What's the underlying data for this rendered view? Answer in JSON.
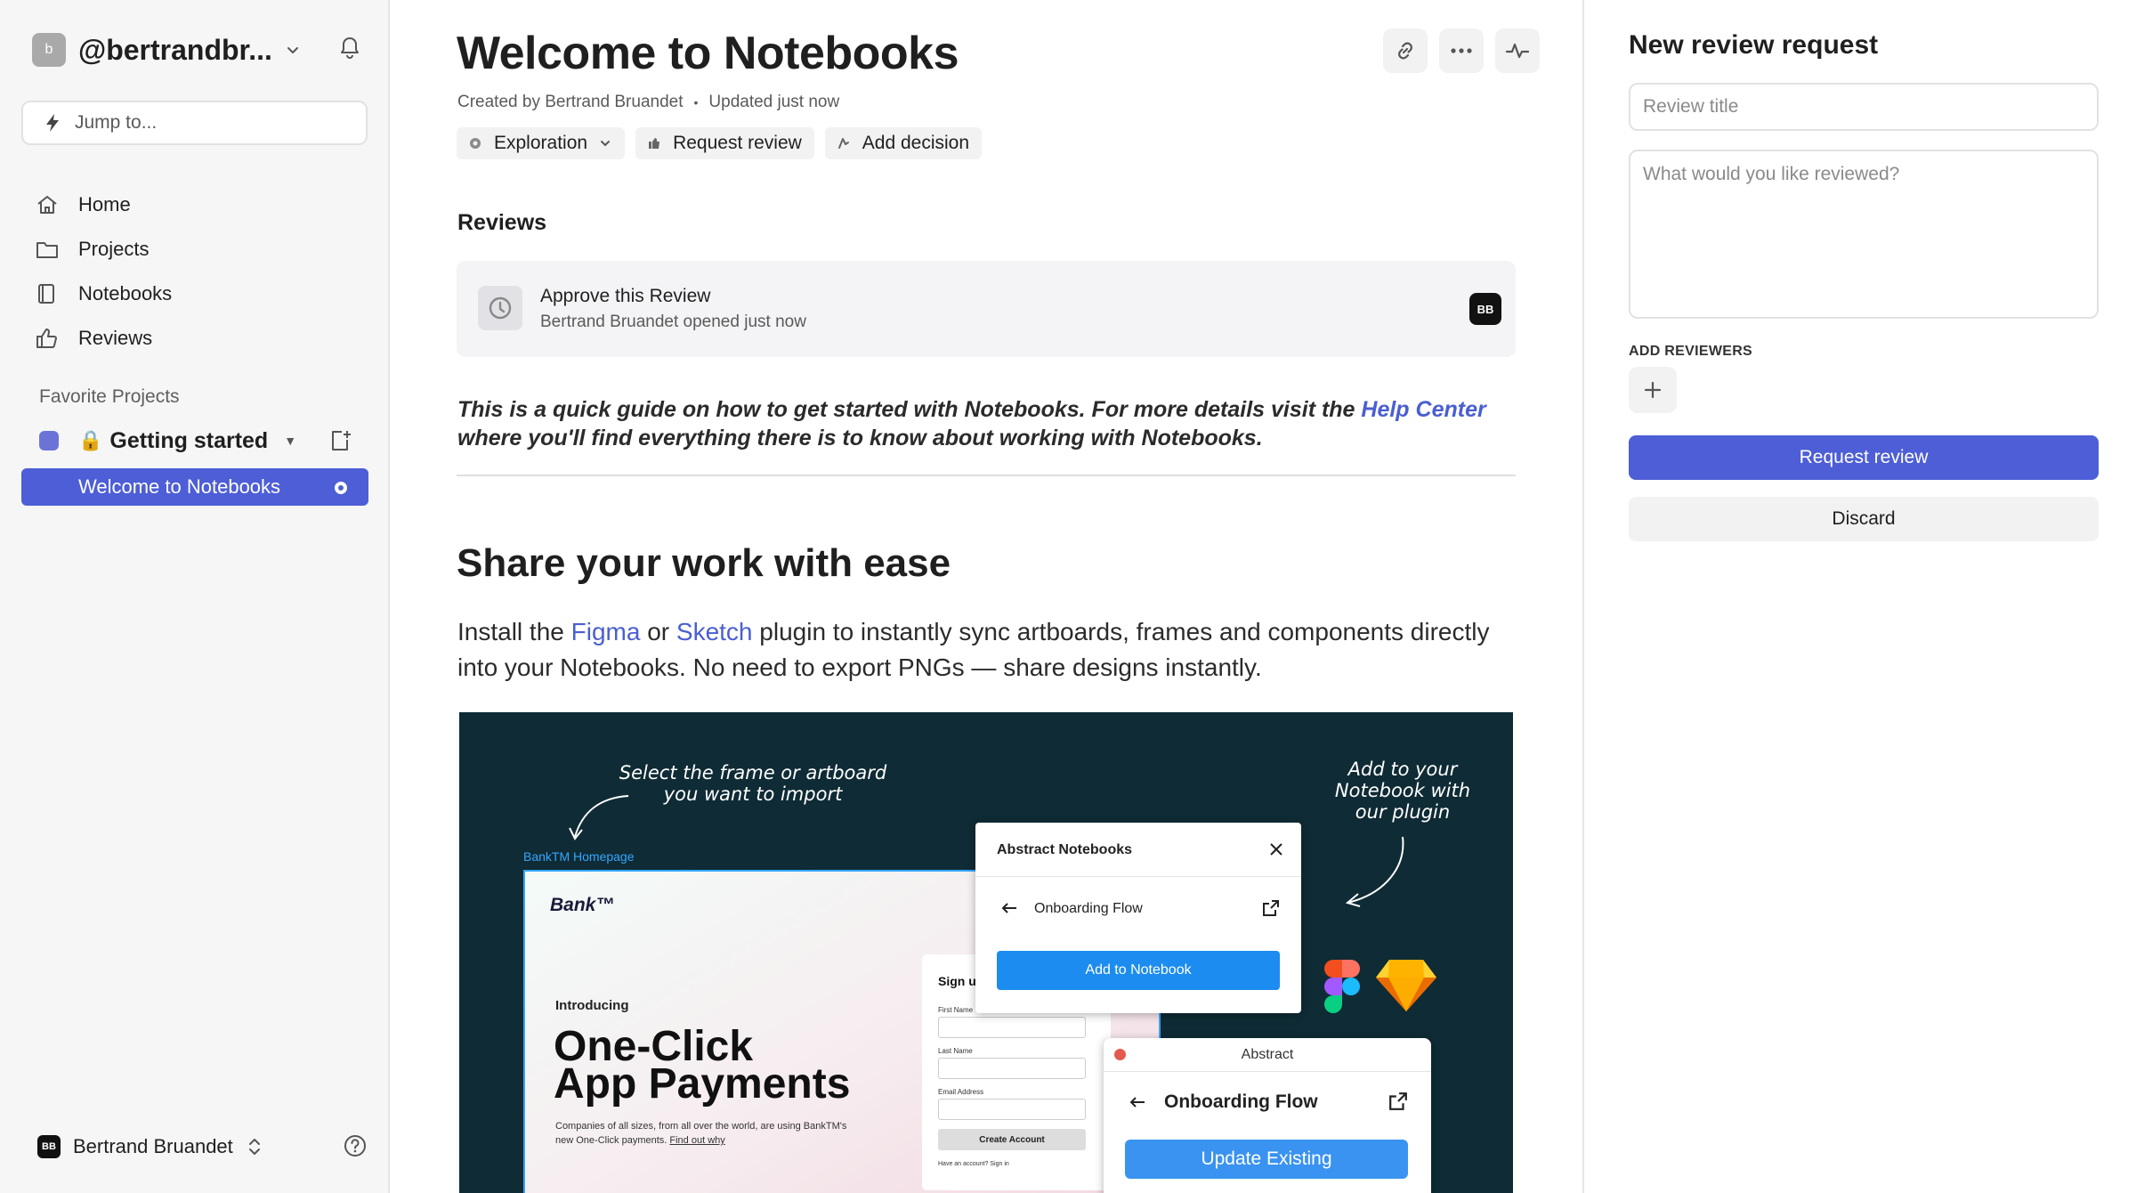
{
  "sidebar": {
    "workspace_initial": "b",
    "workspace_name": "@bertrandbr...",
    "jump_placeholder": "Jump to...",
    "nav": [
      {
        "label": "Home",
        "icon": "home-icon"
      },
      {
        "label": "Projects",
        "icon": "folder-icon"
      },
      {
        "label": "Notebooks",
        "icon": "notebook-icon"
      },
      {
        "label": "Reviews",
        "icon": "thumbs-up-icon"
      }
    ],
    "favorites_title": "Favorite Projects",
    "favorite_project": {
      "lock": "🔒",
      "name": "Getting started",
      "color": "#6b74d6"
    },
    "active_notebook": "Welcome to Notebooks",
    "user": {
      "initials": "BB",
      "name": "Bertrand Bruandet"
    }
  },
  "main": {
    "title": "Welcome to Notebooks",
    "meta": {
      "created": "Created by Bertrand Bruandet",
      "separator": "•",
      "updated": "Updated just now"
    },
    "pills": {
      "exploration": "Exploration",
      "request_review": "Request review",
      "add_decision": "Add decision"
    },
    "reviews_heading": "Reviews",
    "review": {
      "title": "Approve this Review",
      "subtitle": "Bertrand Bruandet opened just now",
      "avatar": "BB"
    },
    "intro": {
      "before": "This is a quick guide on how to get started with Notebooks. For more details visit the ",
      "link": "Help Center",
      "after": " where you'll find everything there is to know about working with Notebooks."
    },
    "section_heading": "Share your work with ease",
    "paragraph": {
      "p1": "Install the ",
      "figma": "Figma",
      "p2": " or ",
      "sketch": "Sketch",
      "p3": " plugin to instantly sync artboards, frames and components directly into your Notebooks. No need to export PNGs — share designs instantly."
    },
    "embed": {
      "annotation_left_1": "Select the frame or artboard",
      "annotation_left_2": "you want to import",
      "annotation_right_1": "Add to your",
      "annotation_right_2": "Notebook with",
      "annotation_right_3": "our plugin",
      "frame_label": "BankTM Homepage",
      "bank_logo": "Bank™",
      "introducing": "Introducing",
      "big_title_1": "One-Click",
      "big_title_2": "App Payments",
      "small_text": "Companies of all sizes, from all over the world, are using BankTM's new One-Click payments.",
      "small_link": "Find out why",
      "signup_title": "Sign up fo",
      "field_first": "First Name",
      "field_last": "Last Name",
      "field_email": "Email Address",
      "create_account": "Create Account",
      "have_account": "Have an account? Sign in",
      "plugin_title": "Abstract Notebooks",
      "plugin_flow": "Onboarding Flow",
      "plugin_button": "Add to Notebook",
      "window_title": "Abstract",
      "window_flow": "Onboarding Flow",
      "window_button": "Update Existing"
    }
  },
  "panel": {
    "title": "New review request",
    "title_placeholder": "Review title",
    "desc_placeholder": "What would you like reviewed?",
    "reviewers_label": "ADD REVIEWERS",
    "primary_button": "Request review",
    "secondary_button": "Discard"
  },
  "colors": {
    "accent": "#4d5ed6",
    "link": "#4a5fd0",
    "embed_bg": "#0f2b35",
    "plugin_blue": "#1c8cf0"
  }
}
